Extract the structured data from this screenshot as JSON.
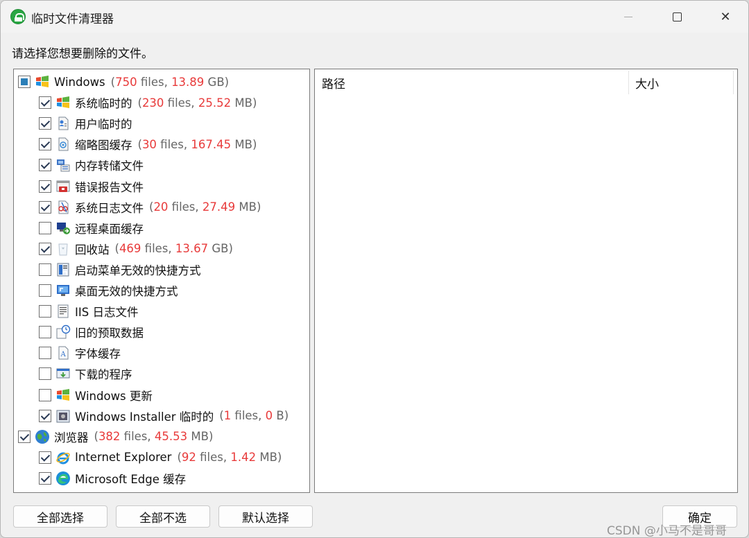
{
  "window": {
    "title": "临时文件清理器",
    "minimize_icon": "minimize-icon",
    "maximize_icon": "maximize-icon",
    "close_icon": "close-icon",
    "close_glyph": "✕"
  },
  "prompt": "请选择您想要删除的文件。",
  "tree": [
    {
      "level": 0,
      "checked": "partial",
      "icon": "windows-logo-icon",
      "label": "Windows",
      "count": "750 files",
      "size": "13.89 GB"
    },
    {
      "level": 1,
      "checked": "checked",
      "icon": "windows-logo-icon",
      "label": "系统临时的",
      "count": "230 files",
      "size": "25.52 MB"
    },
    {
      "level": 1,
      "checked": "checked",
      "icon": "user-file-icon",
      "label": "用户临时的",
      "count": "",
      "size": ""
    },
    {
      "level": 1,
      "checked": "checked",
      "icon": "thumbnail-icon",
      "label": "缩略图缓存",
      "count": "30 files",
      "size": "167.45 MB"
    },
    {
      "level": 1,
      "checked": "checked",
      "icon": "memory-dump-icon",
      "label": "内存转储文件",
      "count": "",
      "size": ""
    },
    {
      "level": 1,
      "checked": "checked",
      "icon": "error-report-icon",
      "label": "错误报告文件",
      "count": "",
      "size": ""
    },
    {
      "level": 1,
      "checked": "checked",
      "icon": "system-log-icon",
      "label": "系统日志文件",
      "count": "20 files",
      "size": "27.49 MB"
    },
    {
      "level": 1,
      "checked": "unchecked",
      "icon": "remote-desktop-icon",
      "label": "远程桌面缓存",
      "count": "",
      "size": ""
    },
    {
      "level": 1,
      "checked": "checked",
      "icon": "recycle-bin-icon",
      "label": "回收站",
      "count": "469 files",
      "size": "13.67 GB"
    },
    {
      "level": 1,
      "checked": "unchecked",
      "icon": "start-menu-shortcut-icon",
      "label": "启动菜单无效的快捷方式",
      "count": "",
      "size": ""
    },
    {
      "level": 1,
      "checked": "unchecked",
      "icon": "desktop-shortcut-icon",
      "label": "桌面无效的快捷方式",
      "count": "",
      "size": ""
    },
    {
      "level": 1,
      "checked": "unchecked",
      "icon": "iis-log-icon",
      "label": "IIS 日志文件",
      "count": "",
      "size": ""
    },
    {
      "level": 1,
      "checked": "unchecked",
      "icon": "prefetch-icon",
      "label": "旧的预取数据",
      "count": "",
      "size": ""
    },
    {
      "level": 1,
      "checked": "unchecked",
      "icon": "font-cache-icon",
      "label": "字体缓存",
      "count": "",
      "size": ""
    },
    {
      "level": 1,
      "checked": "unchecked",
      "icon": "downloaded-program-icon",
      "label": "下载的程序",
      "count": "",
      "size": ""
    },
    {
      "level": 1,
      "checked": "unchecked",
      "icon": "windows-update-icon",
      "label": "Windows 更新",
      "count": "",
      "size": ""
    },
    {
      "level": 1,
      "checked": "checked",
      "icon": "windows-installer-icon",
      "label": "Windows Installer 临时的",
      "count": "1 files",
      "size": "0 B"
    },
    {
      "level": 0,
      "checked": "checked",
      "icon": "globe-icon",
      "label": "浏览器",
      "count": "382 files",
      "size": "45.53 MB"
    },
    {
      "level": 1,
      "checked": "checked",
      "icon": "internet-explorer-icon",
      "label": "Internet Explorer",
      "count": "92 files",
      "size": "1.42 MB"
    },
    {
      "level": 1,
      "checked": "checked",
      "icon": "edge-icon",
      "label": "Microsoft Edge 缓存",
      "count": "",
      "size": ""
    }
  ],
  "list": {
    "col_path": "路径",
    "col_size": "大小"
  },
  "buttons": {
    "select_all": "全部选择",
    "select_none": "全部不选",
    "default_select": "默认选择",
    "ok": "确定"
  },
  "watermark": "CSDN @小马不是哥哥"
}
